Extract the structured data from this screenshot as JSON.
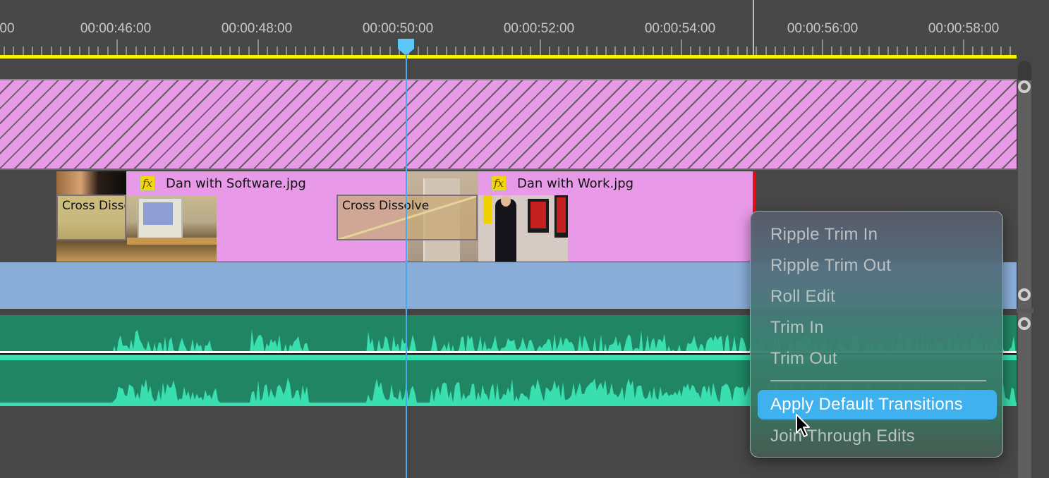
{
  "ruler": {
    "labels": [
      "00",
      "00:00:46:00",
      "00:00:48:00",
      "00:00:50:00",
      "00:00:52:00",
      "00:00:54:00",
      "00:00:56:00",
      "00:00:58:00"
    ],
    "playhead_timecode": "00:00:50:00"
  },
  "tracks": {
    "video_clips": [
      {
        "name": "Dan with Software.jpg",
        "fx_label": "fx"
      },
      {
        "name": "Dan with Work.jpg",
        "fx_label": "fx"
      }
    ],
    "transitions": [
      {
        "label": "Cross Disso"
      },
      {
        "label": "Cross Dissolve"
      }
    ]
  },
  "context_menu": {
    "items": [
      {
        "label": "Ripple Trim In",
        "highlighted": false
      },
      {
        "label": "Ripple Trim Out",
        "highlighted": false
      },
      {
        "label": "Roll Edit",
        "highlighted": false
      },
      {
        "label": "Trim In",
        "highlighted": false
      },
      {
        "label": "Trim Out",
        "highlighted": false
      },
      {
        "label": "Apply Default Transitions",
        "highlighted": true
      },
      {
        "label": "Join Through Edits",
        "highlighted": false
      }
    ]
  },
  "colors": {
    "accent": "#3eb1ee",
    "playhead": "#48a9f2",
    "work_area": "#f5f500",
    "video_clip": "#e89ae8",
    "audio_clip": "#1f8563",
    "waveform": "#39dfae"
  }
}
